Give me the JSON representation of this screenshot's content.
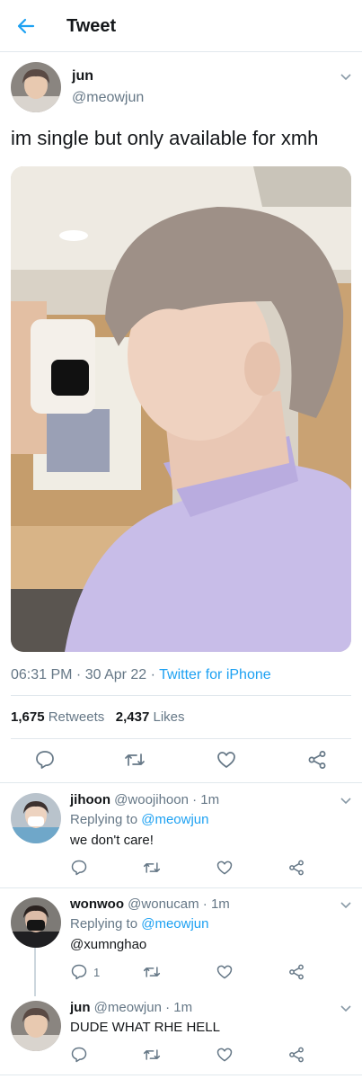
{
  "header": {
    "title": "Tweet"
  },
  "main": {
    "name": "jun",
    "handle": "@meowjun",
    "text": "im single but only available for xmh",
    "time": "06:31 PM · 30 Apr 22 · ",
    "client": "Twitter for iPhone",
    "retweets": "1,675",
    "retweets_label": "Retweets",
    "likes": "2,437",
    "likes_label": "Likes"
  },
  "replies": [
    {
      "name": "jihoon",
      "handle": "@woojihoon",
      "time": " · 1m",
      "replying_prefix": "Replying to ",
      "replying_to": "@meowjun",
      "text": "we don't care!",
      "reply_count": ""
    },
    {
      "name": "wonwoo",
      "handle": "@wonucam",
      "time": " · 1m",
      "replying_prefix": "Replying to ",
      "replying_to": "@meowjun",
      "text": "@xumnghao",
      "reply_count": "1"
    },
    {
      "name": "jun",
      "handle": "@meowjun",
      "time": " · 1m",
      "text": "DUDE WHAT RHE HELL",
      "reply_count": ""
    }
  ],
  "colors": {
    "accent": "#1da1f2",
    "text": "#14171a",
    "muted": "#657786",
    "divider": "#e1e8ed",
    "shirt": "#c8bde8"
  },
  "icons": [
    "back-arrow-icon",
    "chevron-down-icon",
    "reply-icon",
    "retweet-icon",
    "like-icon",
    "share-icon"
  ]
}
